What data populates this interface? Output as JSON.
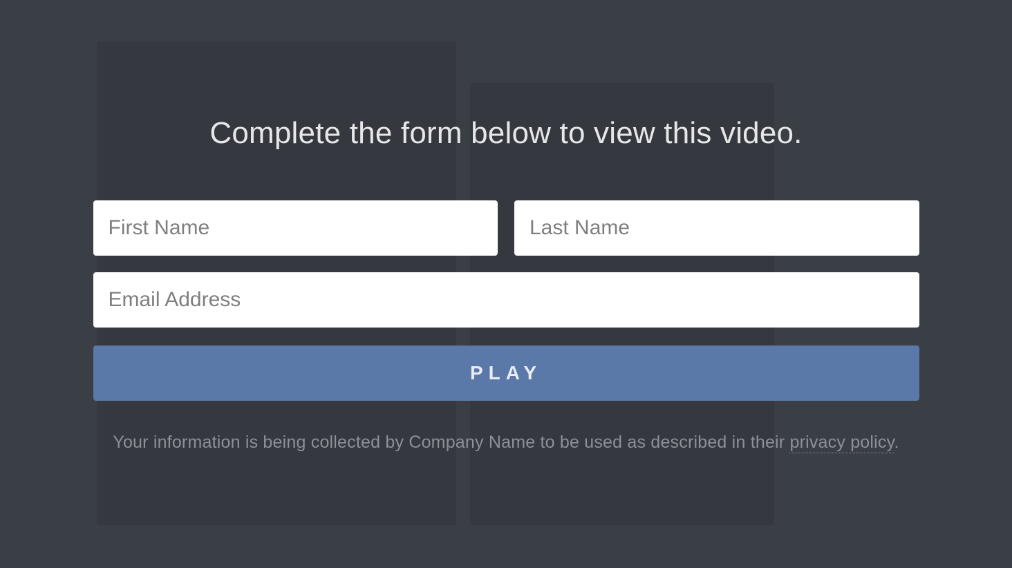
{
  "heading": "Complete the form below to view this video.",
  "form": {
    "first_name_placeholder": "First Name",
    "last_name_placeholder": "Last Name",
    "email_placeholder": "Email Address",
    "play_label": "PLAY"
  },
  "disclaimer": {
    "text_before": "Your information is being collected by Company Name to be used as described in their ",
    "link_text": "privacy policy",
    "text_after": "."
  }
}
